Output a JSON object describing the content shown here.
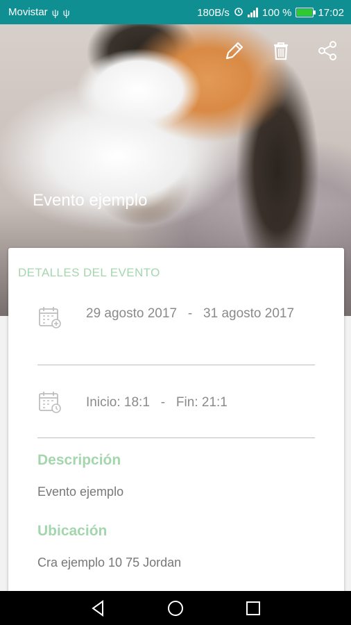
{
  "status": {
    "carrier": "Movistar",
    "usb1": "ψ",
    "usb2": "ψ",
    "net_speed": "180B/s",
    "battery": "100 %",
    "battery_level": 1,
    "time": "17:02"
  },
  "hero": {
    "title": "Evento ejemplo",
    "actions": {
      "edit": "pencil-icon",
      "delete": "trash-icon",
      "share": "share-icon"
    }
  },
  "card": {
    "heading": "DETALLES DEL EVENTO",
    "date_start": "29 agosto 2017",
    "date_sep": "-",
    "date_end": "31 agosto 2017",
    "time_start": "Inicio: 18:1",
    "time_sep": "-",
    "time_end": "Fin: 21:1",
    "description_title": "Descripción",
    "description": "Evento ejemplo",
    "location_title": "Ubicación",
    "location": "Cra ejemplo 10 75 Jordan"
  },
  "colors": {
    "statusbar": "#0f8f91",
    "accent": "#a4d6ad"
  }
}
